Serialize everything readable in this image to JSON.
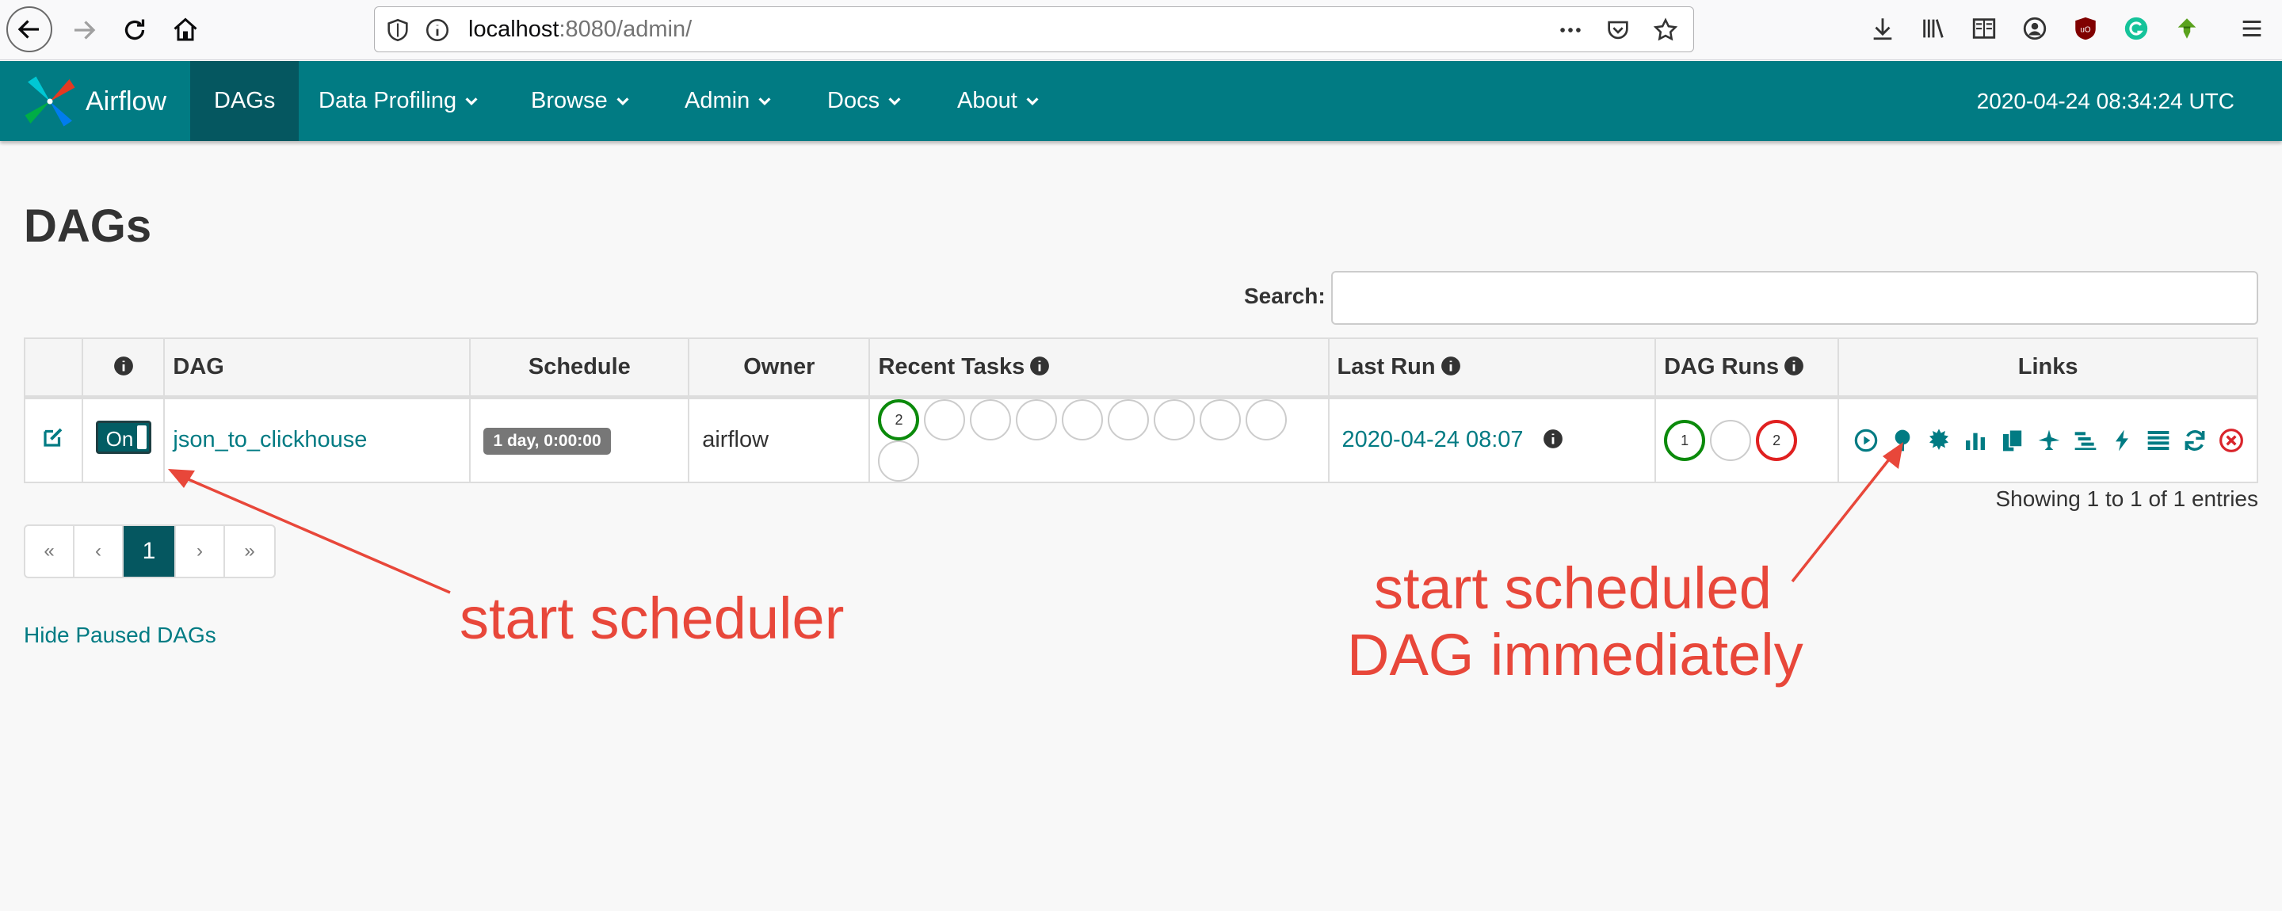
{
  "browser": {
    "url_host": "localhost",
    "url_rest": ":8080/admin/",
    "icons": [
      "back-arrow-icon",
      "forward-arrow-icon",
      "reload-icon",
      "home-icon",
      "shield-icon",
      "info-icon",
      "more-dots-icon",
      "pocket-icon",
      "bookmark-star-icon",
      "download-icon",
      "library-icon",
      "reader-icon",
      "account-icon",
      "ublock-icon",
      "grammarly-icon",
      "download-helper-icon",
      "hamburger-menu-icon"
    ]
  },
  "navbar": {
    "brand": "Airflow",
    "items": [
      {
        "label": "DAGs"
      },
      {
        "label": "Data Profiling"
      },
      {
        "label": "Browse"
      },
      {
        "label": "Admin"
      },
      {
        "label": "Docs"
      },
      {
        "label": "About"
      }
    ],
    "clock": "2020-04-24 08:34:24 UTC"
  },
  "page": {
    "title": "DAGs",
    "search_label": "Search:",
    "search_value": ""
  },
  "table": {
    "headers": {
      "dag": "DAG",
      "schedule": "Schedule",
      "owner": "Owner",
      "recent_tasks": "Recent Tasks",
      "last_run": "Last Run",
      "dag_runs": "DAG Runs",
      "links": "Links"
    },
    "rows": [
      {
        "toggle": "On",
        "dag_id": "json_to_clickhouse",
        "schedule": "1 day, 0:00:00",
        "owner": "airflow",
        "recent_tasks": [
          "2",
          "",
          "",
          "",
          "",
          "",
          "",
          "",
          "",
          ""
        ],
        "last_run": "2020-04-24 08:07",
        "dag_runs": [
          "1",
          "",
          "2"
        ]
      }
    ],
    "link_icons": [
      "trigger-dag-icon",
      "tree-view-icon",
      "graph-view-icon",
      "duration-icon",
      "task-tries-icon",
      "landing-times-icon",
      "gantt-icon",
      "code-icon",
      "logs-icon",
      "refresh-icon",
      "delete-icon"
    ]
  },
  "entries_text": "Showing 1 to 1 of 1 entries",
  "pagination": {
    "first": "«",
    "prev": "‹",
    "current": "1",
    "next": "›",
    "last": "»"
  },
  "hide_paused": "Hide Paused DAGs",
  "annotations": {
    "left": "start scheduler",
    "right_line1": "start scheduled",
    "right_line2": "DAG immediately"
  },
  "colors": {
    "navbar": "#017b83",
    "navbar_active": "#055760",
    "annotation": "#e8473a",
    "success": "#0b8a0b",
    "failed": "#e02020"
  }
}
